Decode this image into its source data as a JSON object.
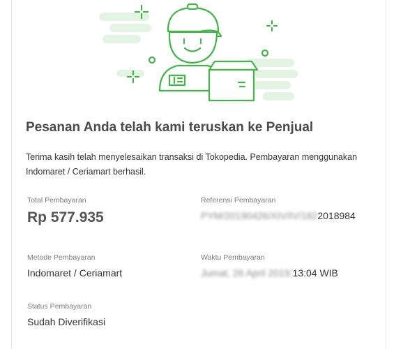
{
  "header": {
    "title": "Pesanan Anda telah kami teruskan ke Penjual",
    "description": "Terima kasih telah menyelesaikan transaksi di Tokopedia. Pembayaran menggunakan Indomaret / Ceriamart berhasil."
  },
  "payment": {
    "total": {
      "label": "Total Pembayaran",
      "value": "Rp 577.935"
    },
    "reference": {
      "label": "Referensi Pembayaran",
      "value_hidden": "PYM/20190426/XIV/IV/182",
      "value_visible": "2018984"
    },
    "method": {
      "label": "Metode Pembayaran",
      "value": "Indomaret / Ceriamart"
    },
    "time": {
      "label": "Waktu Pembayaran",
      "value_hidden": "Jumat, 26 April 2019,",
      "value_visible": " 13:04 WIB"
    },
    "status": {
      "label": "Status Pembayaran",
      "value": "Sudah Diverifikasi"
    }
  },
  "colors": {
    "accent_green": "#42b549",
    "light_green": "#e3f3e4"
  },
  "icons": {
    "hero": "courier-with-package-illustration"
  }
}
